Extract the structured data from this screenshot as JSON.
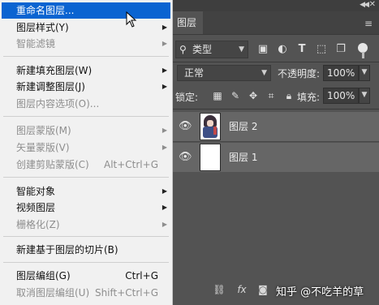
{
  "layers_panel": {
    "tab_label": "图层",
    "kind_filter": "类型",
    "blend_mode": "正常",
    "opacity_label": "不透明度:",
    "opacity_value": "100%",
    "lock_label": "锁定:",
    "fill_label": "填充:",
    "fill_value": "100%",
    "layers": [
      {
        "name": "图层 2"
      },
      {
        "name": "图层 1"
      }
    ],
    "bottom_icons": [
      "link-icon",
      "fx-icon",
      "mask-icon"
    ],
    "watermark": "知乎 @不吃羊的草"
  },
  "context_menu": {
    "items": [
      {
        "label": "重命名图层...",
        "state": "highlighted"
      },
      {
        "label": "图层样式(Y)",
        "submenu": true
      },
      {
        "label": "智能滤镜",
        "disabled": true,
        "submenu": true
      },
      {
        "label": "新建填充图层(W)",
        "submenu": true
      },
      {
        "label": "新建调整图层(J)",
        "submenu": true
      },
      {
        "label": "图层内容选项(O)...",
        "disabled": true
      },
      {
        "label": "图层蒙版(M)",
        "disabled": true,
        "submenu": true
      },
      {
        "label": "矢量蒙版(V)",
        "disabled": true,
        "submenu": true
      },
      {
        "label": "创建剪贴蒙版(C)",
        "disabled": true,
        "shortcut": "Alt+Ctrl+G"
      },
      {
        "label": "智能对象",
        "submenu": true
      },
      {
        "label": "视频图层",
        "submenu": true
      },
      {
        "label": "栅格化(Z)",
        "disabled": true,
        "submenu": true
      },
      {
        "label": "新建基于图层的切片(B)"
      },
      {
        "label": "图层编组(G)",
        "shortcut": "Ctrl+G"
      },
      {
        "label": "取消图层编组(U)",
        "disabled": true,
        "shortcut": "Shift+Ctrl+G"
      }
    ]
  },
  "colors": {
    "highlight": "#0a64d1",
    "panel_bg": "#535353",
    "layer_row_bg": "#666666"
  }
}
